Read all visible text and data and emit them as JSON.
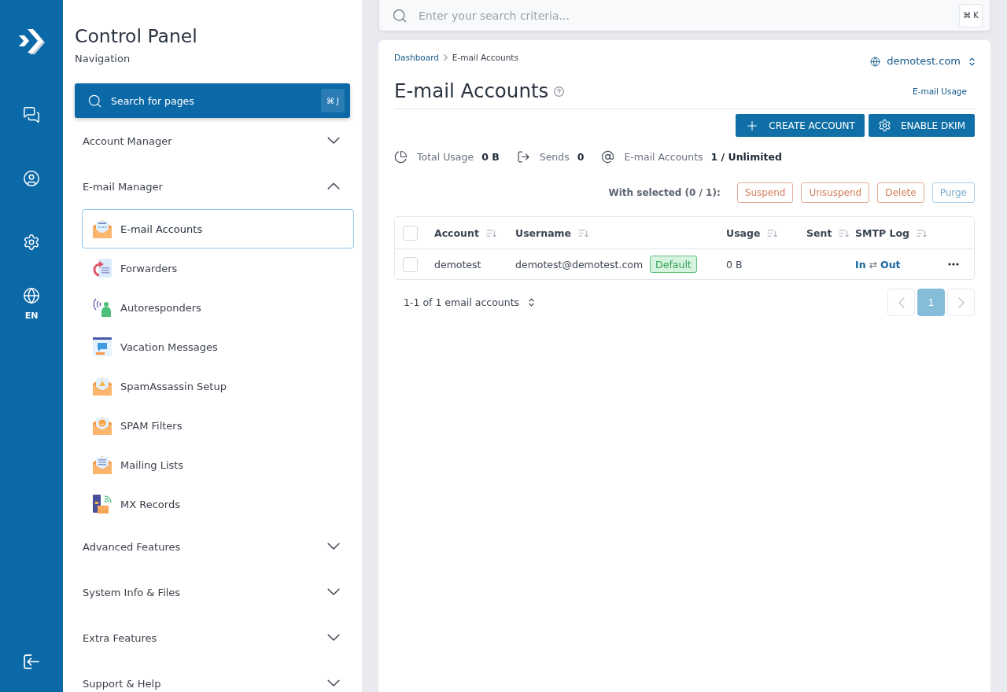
{
  "rail": {
    "language": "EN"
  },
  "sidebar": {
    "title": "Control Panel",
    "subtitle": "Navigation",
    "search": {
      "label": "Search for pages",
      "shortcut": "⌘ J"
    },
    "sections": [
      {
        "label": "Account Manager",
        "expanded": false
      },
      {
        "label": "E-mail Manager",
        "expanded": true,
        "children": [
          {
            "label": "E-mail Accounts",
            "selected": true
          },
          {
            "label": "Forwarders",
            "selected": false
          },
          {
            "label": "Autoresponders",
            "selected": false
          },
          {
            "label": "Vacation Messages",
            "selected": false
          },
          {
            "label": "SpamAssassin Setup",
            "selected": false
          },
          {
            "label": "SPAM Filters",
            "selected": false
          },
          {
            "label": "Mailing Lists",
            "selected": false
          },
          {
            "label": "MX Records",
            "selected": false
          }
        ]
      },
      {
        "label": "Advanced Features",
        "expanded": false
      },
      {
        "label": "System Info & Files",
        "expanded": false
      },
      {
        "label": "Extra Features",
        "expanded": false
      },
      {
        "label": "Support & Help",
        "expanded": false
      }
    ]
  },
  "topbar": {
    "search": {
      "placeholder": "Enter your search criteria...",
      "shortcut": "⌘ K"
    }
  },
  "content": {
    "breadcrumb": [
      {
        "label": "Dashboard",
        "kind": "link"
      },
      {
        "label": "E-mail Accounts",
        "kind": "current"
      }
    ],
    "domain": "demotest.com",
    "title": "E-mail Accounts",
    "usage_link": "E-mail Usage",
    "actions": [
      {
        "label": "CREATE ACCOUNT",
        "kind": "create"
      },
      {
        "label": "ENABLE DKIM",
        "kind": "settings"
      }
    ],
    "stats": [
      {
        "label": "Total Usage",
        "value": "0 B",
        "kind": "usage"
      },
      {
        "label": "Sends",
        "value": "0",
        "kind": "sends"
      },
      {
        "label": "E-mail Accounts",
        "value": "1 / Unlimited",
        "kind": "accounts"
      }
    ],
    "bulk": {
      "label": "With selected (0 / 1):",
      "actions": [
        {
          "label": "Suspend",
          "kind": "danger"
        },
        {
          "label": "Unsuspend",
          "kind": "danger"
        },
        {
          "label": "Delete",
          "kind": "danger"
        },
        {
          "label": "Purge",
          "kind": "info"
        }
      ]
    },
    "table": {
      "select_all": {
        "checked": false
      },
      "columns": [
        "Account",
        "Username",
        "Usage",
        "Sent",
        "SMTP Log"
      ],
      "rows": [
        {
          "checked": false,
          "account": "demotest",
          "username": "demotest@demotest.com",
          "badge": "Default",
          "usage": "0 B",
          "smtp_log": {
            "in": "In",
            "separator": "⇄",
            "out": "Out"
          }
        }
      ]
    },
    "footer": {
      "summary": "1-1 of 1 email accounts",
      "pages": [
        {
          "label": "1",
          "selected": true
        }
      ]
    }
  }
}
